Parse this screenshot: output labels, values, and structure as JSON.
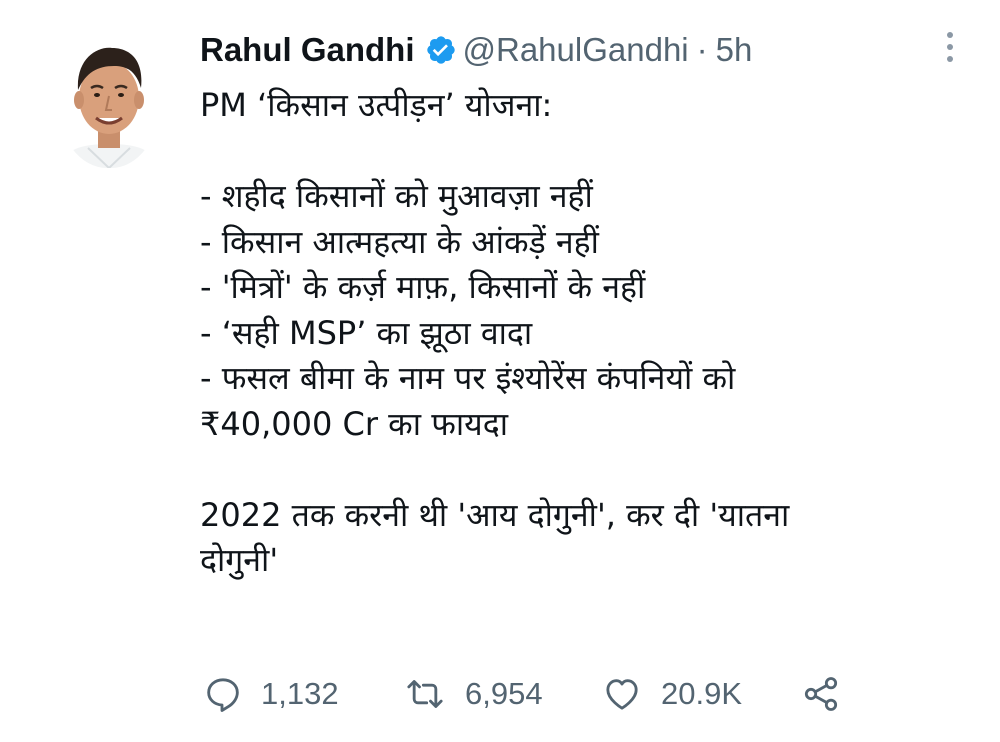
{
  "tweet": {
    "author_name": "Rahul Gandhi",
    "handle": "@RahulGandhi",
    "separator": "·",
    "time": "5h",
    "text_lines": [
      "PM ‘किसान उत्पीड़न’ योजना:",
      "",
      "- शहीद किसानों को मुआवज़ा नहीं",
      "- किसान आत्महत्या के आंकड़ें नहीं",
      "- 'मित्रों' के कर्ज़ माफ़, किसानों के नहीं",
      "- ‘सही MSP’ का झूठा वादा",
      "- फसल बीमा के नाम पर इंश्योरेंस कंपनियों को",
      "₹40,000 Cr का फायदा",
      "",
      "2022 तक करनी थी 'आय दोगुनी', कर दी 'यातना",
      "दोगुनी'"
    ],
    "stats": {
      "replies": "1,132",
      "retweets": "6,954",
      "likes": "20.9K"
    }
  },
  "icons": {
    "verified": "verified-badge-icon",
    "more": "more-vertical-icon",
    "reply": "reply-icon",
    "retweet": "retweet-icon",
    "like": "heart-icon",
    "share": "share-icon"
  },
  "colors": {
    "verified_blue": "#1d9bf0",
    "muted_text": "#536471",
    "primary_text": "#0f1419"
  }
}
